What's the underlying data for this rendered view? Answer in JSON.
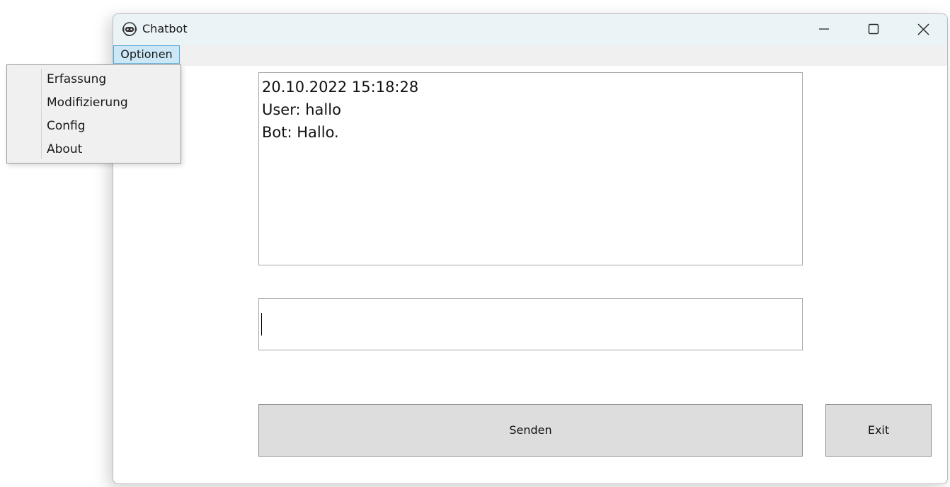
{
  "window": {
    "title": "Chatbot",
    "icon": "robot-headset-icon",
    "controls": {
      "minimize_icon": "minimize-icon",
      "maximize_icon": "maximize-icon",
      "close_icon": "close-icon"
    }
  },
  "menubar": {
    "items": [
      {
        "label": "Optionen",
        "open": true
      }
    ]
  },
  "dropdown": {
    "items": [
      {
        "label": "Erfassung"
      },
      {
        "label": "Modifizierung"
      },
      {
        "label": "Config"
      },
      {
        "label": "About"
      }
    ]
  },
  "chat": {
    "lines": [
      "20.10.2022 15:18:28",
      "User: hallo",
      "Bot: Hallo."
    ]
  },
  "message_input": {
    "value": ""
  },
  "buttons": {
    "send_label": "Senden",
    "exit_label": "Exit"
  },
  "colors": {
    "titlebar": "#eaf4f7",
    "menu_highlight": "#cce8f7",
    "button_face": "#dddddd"
  }
}
